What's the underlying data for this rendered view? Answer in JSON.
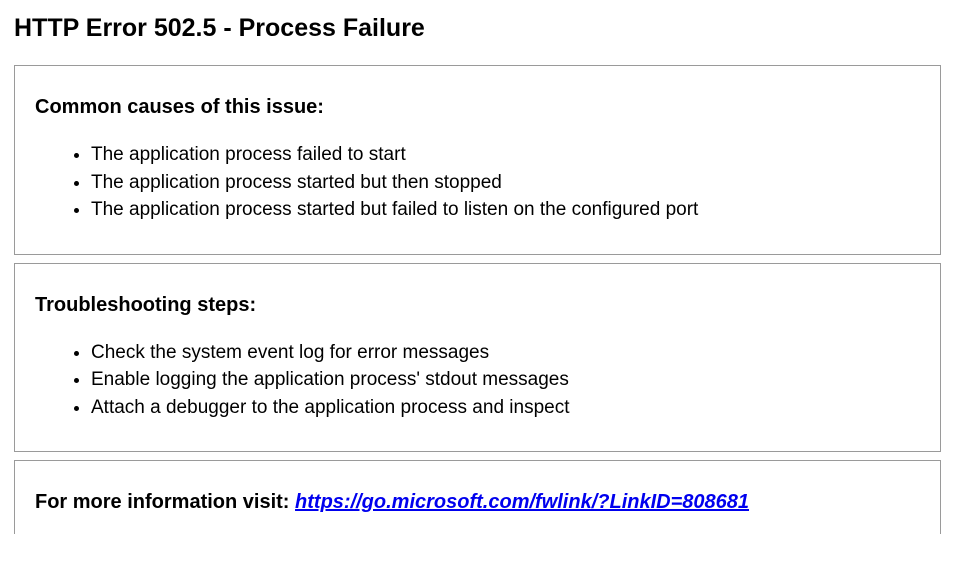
{
  "title": "HTTP Error 502.5 - Process Failure",
  "sections": [
    {
      "heading": "Common causes of this issue:",
      "items": [
        "The application process failed to start",
        "The application process started but then stopped",
        "The application process started but failed to listen on the configured port"
      ]
    },
    {
      "heading": "Troubleshooting steps:",
      "items": [
        "Check the system event log for error messages",
        "Enable logging the application process' stdout messages",
        "Attach a debugger to the application process and inspect"
      ]
    }
  ],
  "more_info": {
    "prefix": "For more information visit: ",
    "link_text": "https://go.microsoft.com/fwlink/?LinkID=808681"
  }
}
